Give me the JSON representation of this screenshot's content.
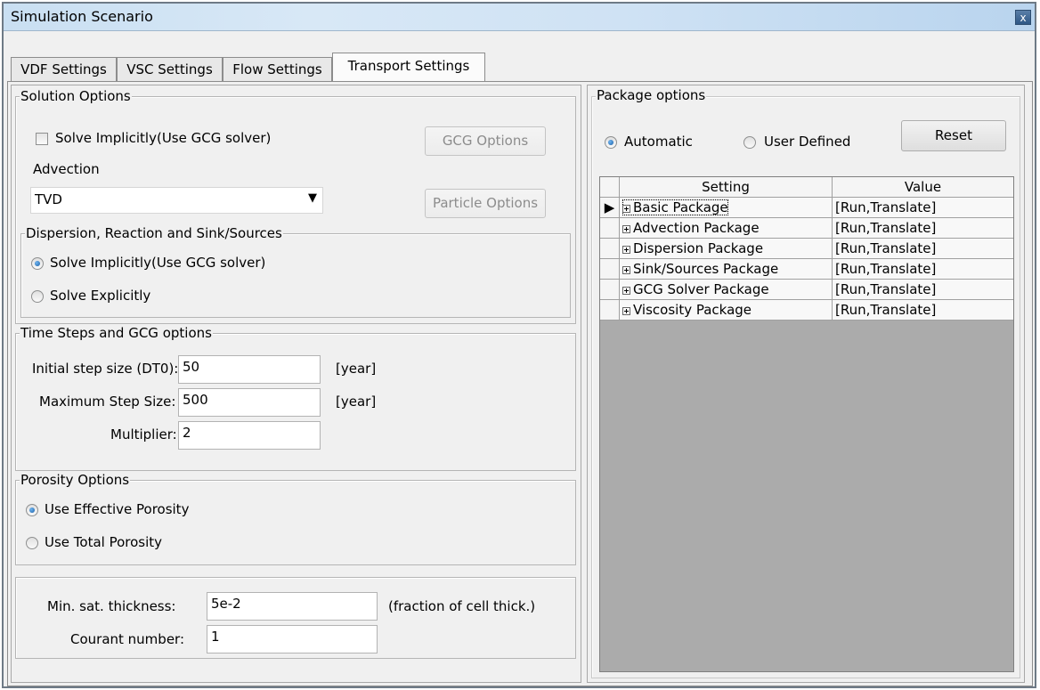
{
  "window": {
    "title": "Simulation Scenario",
    "close_glyph": "x"
  },
  "tabs": [
    {
      "label": "VDF Settings"
    },
    {
      "label": "VSC Settings"
    },
    {
      "label": "Flow Settings"
    },
    {
      "label": "Transport Settings",
      "active": true
    }
  ],
  "solution_options": {
    "legend": "Solution Options",
    "solve_implicitly_label": "Solve Implicitly(Use GCG solver)",
    "solve_implicitly_checked": false,
    "gcg_options_button": "GCG Options",
    "advection_label": "Advection",
    "advection_value": "TVD",
    "particle_options_button": "Particle Options"
  },
  "dispersion": {
    "legend": "Dispersion, Reaction and Sink/Sources",
    "option_implicit": "Solve Implicitly(Use GCG solver)",
    "option_explicit": "Solve Explicitly",
    "selected": "implicit"
  },
  "time_steps": {
    "legend": "Time Steps and GCG options",
    "initial_label": "Initial step size (DT0):",
    "initial_value": "50",
    "initial_unit": "[year]",
    "max_label": "Maximum Step Size:",
    "max_value": "500",
    "max_unit": "[year]",
    "multiplier_label": "Multiplier:",
    "multiplier_value": "2"
  },
  "porosity": {
    "legend": "Porosity Options",
    "option_effective": "Use Effective Porosity",
    "option_total": "Use Total Porosity",
    "selected": "effective"
  },
  "misc": {
    "min_sat_label": "Min. sat. thickness:",
    "min_sat_value": "5e-2",
    "min_sat_unit": "(fraction of cell thick.)",
    "courant_label": "Courant number:",
    "courant_value": "1"
  },
  "package_options": {
    "legend": "Package options",
    "automatic_label": "Automatic",
    "user_defined_label": "User Defined",
    "selected": "automatic",
    "reset_button": "Reset",
    "columns": [
      "Setting",
      "Value"
    ],
    "rows": [
      {
        "setting": "Basic Package",
        "value": "[Run,Translate]",
        "current": true
      },
      {
        "setting": "Advection Package",
        "value": "[Run,Translate]"
      },
      {
        "setting": "Dispersion Package",
        "value": "[Run,Translate]"
      },
      {
        "setting": "Sink/Sources Package",
        "value": "[Run,Translate]"
      },
      {
        "setting": "GCG Solver Package",
        "value": "[Run,Translate]"
      },
      {
        "setting": "Viscosity Package",
        "value": "[Run,Translate]"
      }
    ]
  }
}
